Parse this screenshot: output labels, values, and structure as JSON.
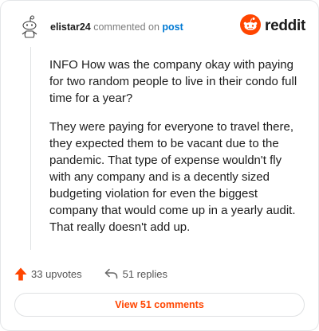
{
  "header": {
    "username": "elistar24",
    "action_text": "commented on",
    "post_link": "post",
    "brand_name": "reddit"
  },
  "comment": {
    "paragraphs": [
      "INFO How was the company okay with paying for two random people to live in their condo full time for a year?",
      "They were paying for everyone to travel there, they expected them to be vacant due to the pandemic. That type of expense wouldn't fly with any company and is a decently sized budgeting violation for even the biggest company that would come up in a yearly audit. That really doesn't add up."
    ]
  },
  "actions": {
    "upvotes_label": "33 upvotes",
    "replies_label": "51 replies"
  },
  "footer": {
    "view_comments_label": "View 51 comments"
  },
  "colors": {
    "brand_orange": "#ff4500",
    "link_blue": "#0079d3",
    "text": "#1c1c1c",
    "muted": "#7c7c7c"
  },
  "icons": {
    "avatar": "snoo-avatar-icon",
    "brand": "reddit-logo-icon",
    "upvote": "upvote-arrow-icon",
    "reply": "reply-arrow-icon"
  }
}
